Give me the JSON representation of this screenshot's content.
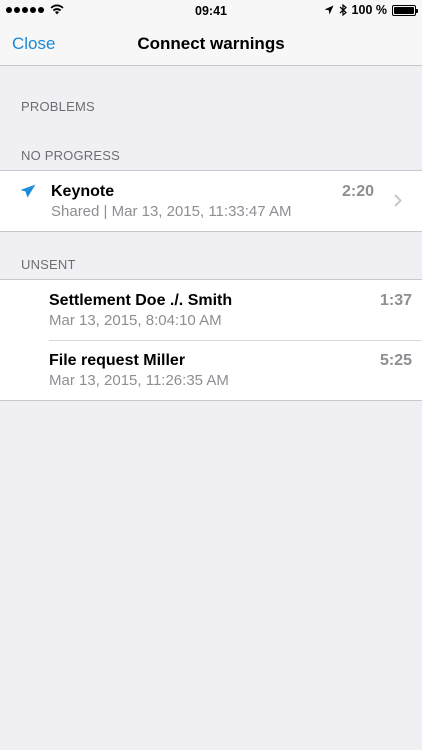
{
  "status_bar": {
    "time": "09:41",
    "battery": "100 %",
    "signal_icon": "signal-dots-icon",
    "wifi_icon": "wifi-icon",
    "location_icon": "location-arrow-icon",
    "bluetooth_icon": "bluetooth-icon",
    "battery_icon": "battery-icon",
    "battery_level": 1.0
  },
  "nav": {
    "close_label": "Close",
    "title": "Connect warnings"
  },
  "sections": {
    "problems": {
      "header": "PROBLEMS"
    },
    "no_progress": {
      "header": "NO PROGRESS",
      "items": [
        {
          "title": "Keynote",
          "subtitle": "Shared | Mar 13, 2015, 11:33:47 AM",
          "time": "2:20",
          "icon": "paper-plane-icon"
        }
      ]
    },
    "unsent": {
      "header": "UNSENT",
      "items": [
        {
          "title": "Settlement Doe ./. Smith",
          "subtitle": "Mar 13, 2015, 8:04:10 AM",
          "time": "1:37"
        },
        {
          "title": "File request Miller",
          "subtitle": "Mar 13, 2015, 11:26:35 AM",
          "time": "5:25"
        }
      ]
    }
  },
  "colors": {
    "accent": "#1a8ad8",
    "background": "#efeff4",
    "secondary_text": "#8e8e93"
  }
}
